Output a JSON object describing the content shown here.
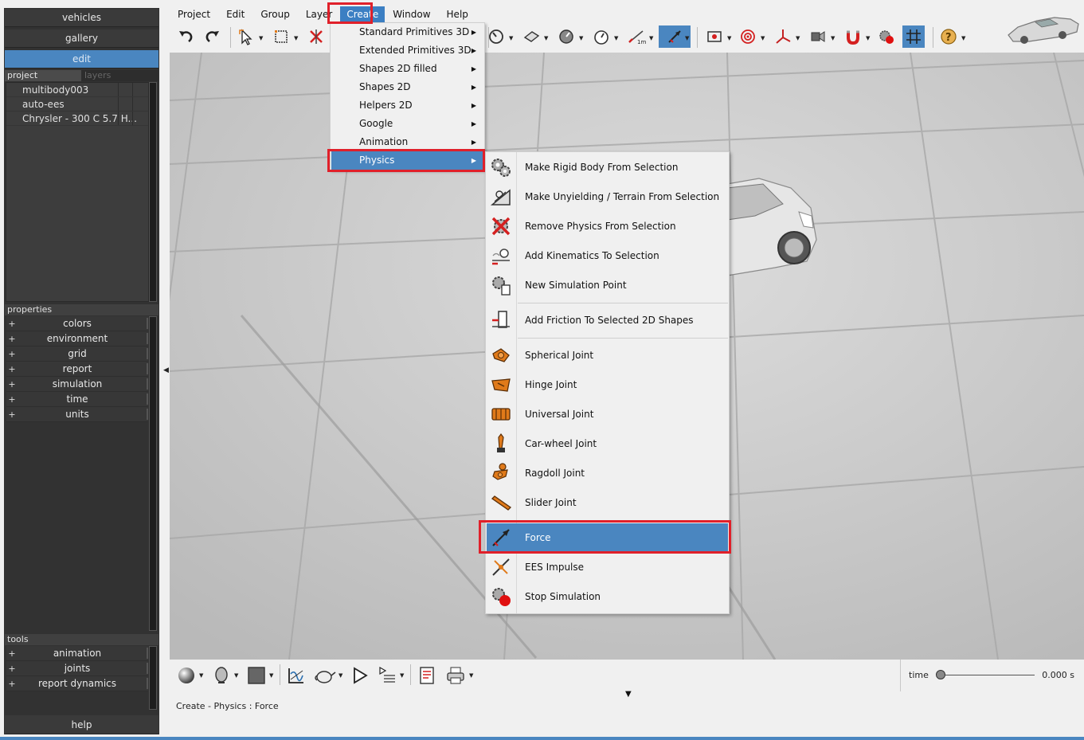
{
  "left_panel": {
    "nav": [
      "vehicles",
      "gallery",
      "edit"
    ],
    "project_tabs": [
      "project",
      "layers"
    ],
    "project_items": [
      "multibody003",
      "auto-ees",
      "Chrysler - 300 C 5.7 H..."
    ],
    "properties_header": "properties",
    "properties_items": [
      "colors",
      "environment",
      "grid",
      "report",
      "simulation",
      "time",
      "units"
    ],
    "tools_header": "tools",
    "tools_items": [
      "animation",
      "joints",
      "report dynamics"
    ],
    "help_label": "help",
    "expand_symbol": "+"
  },
  "menubar": [
    "Project",
    "Edit",
    "Group",
    "Layer",
    "Create",
    "Window",
    "Help"
  ],
  "create_menu": [
    "Standard Primitives 3D",
    "Extended Primitives 3D",
    "Shapes 2D filled",
    "Shapes 2D",
    "Helpers 2D",
    "Google",
    "Animation",
    "Physics"
  ],
  "physics_menu": {
    "items": [
      {
        "label": "Make Rigid Body From Selection",
        "icon": "gears-icon"
      },
      {
        "label": "Make Unyielding / Terrain From Selection",
        "icon": "terrain-icon"
      },
      {
        "label": "Remove Physics From Selection",
        "icon": "remove-physics-icon"
      },
      {
        "label": "Add Kinematics To Selection",
        "icon": "kinematics-icon"
      },
      {
        "label": "New Simulation Point",
        "icon": "simulation-point-icon"
      },
      {
        "label": "Add Friction To Selected 2D Shapes",
        "icon": "friction-icon"
      },
      {
        "label": "Spherical Joint",
        "icon": "spherical-joint-icon"
      },
      {
        "label": "Hinge Joint",
        "icon": "hinge-joint-icon"
      },
      {
        "label": "Universal Joint",
        "icon": "universal-joint-icon"
      },
      {
        "label": "Car-wheel Joint",
        "icon": "car-wheel-joint-icon"
      },
      {
        "label": "Ragdoll Joint",
        "icon": "ragdoll-joint-icon"
      },
      {
        "label": "Slider Joint",
        "icon": "slider-joint-icon"
      },
      {
        "label": "Force",
        "icon": "force-icon"
      },
      {
        "label": "EES Impulse",
        "icon": "impulse-icon"
      },
      {
        "label": "Stop Simulation",
        "icon": "stop-simulation-icon"
      }
    ],
    "selected": "Force"
  },
  "status": {
    "text": "Create - Physics : Force",
    "time_label": "time",
    "time_value": "0.000 s"
  },
  "colors": {
    "accent": "#4a86c0",
    "highlight": "#e0202a",
    "panel": "#323232",
    "joint_orange": "#e07a1a"
  }
}
